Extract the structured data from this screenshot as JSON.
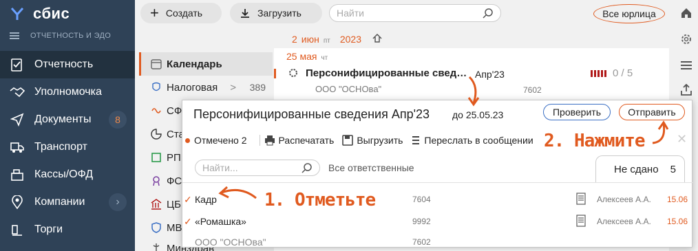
{
  "app": {
    "name": "сбис",
    "section": "ОТЧЕТНОСТЬ И ЭДО"
  },
  "nav": [
    {
      "label": "Отчетность",
      "icon": "report-icon",
      "active": true
    },
    {
      "label": "Уполномочка",
      "icon": "handshake-icon"
    },
    {
      "label": "Документы",
      "icon": "send-icon",
      "badge": "8"
    },
    {
      "label": "Транспорт",
      "icon": "truck-icon"
    },
    {
      "label": "Кассы/ОФД",
      "icon": "cash-register-icon"
    },
    {
      "label": "Компании",
      "icon": "location-icon",
      "chevron": "›"
    },
    {
      "label": "Торги",
      "icon": "auction-icon"
    }
  ],
  "toolbar": {
    "create_label": "Создать",
    "upload_label": "Загрузить",
    "search_placeholder": "Найти",
    "legal_entities": "Все юрлица"
  },
  "datebar": {
    "day": "2",
    "month": "июн",
    "dow": "пт",
    "year": "2023"
  },
  "mid": [
    {
      "label": "Календарь",
      "icon": "calendar-icon"
    },
    {
      "label": "Налоговая",
      "icon": "tax-icon",
      "arrow": ">",
      "count": "389"
    },
    {
      "label": "СФР",
      "icon": "sfr-icon"
    },
    {
      "label": "Статистика",
      "icon": "stats-icon"
    },
    {
      "label": "РПН",
      "icon": "leaf-icon"
    },
    {
      "label": "ФСС",
      "icon": "fss-icon"
    },
    {
      "label": "ЦБ",
      "icon": "bank-icon"
    },
    {
      "label": "МВД",
      "icon": "shield-icon"
    },
    {
      "label": "Минздрав",
      "icon": "health-icon"
    }
  ],
  "main": {
    "date": "25 мая",
    "dow": "чт",
    "row": {
      "title": "Персонифицированные свед…",
      "period": "Апр'23",
      "score": "0 / 5",
      "org": "ООО \"ОСНОва\"",
      "code": "7602"
    }
  },
  "popup": {
    "title": "Персонифицированные сведения Апр'23",
    "due": "до 25.05.23",
    "check_label": "Проверить",
    "send_label": "Отправить",
    "tools": {
      "marked": "Отмечено 2",
      "print": "Распечатать",
      "export": "Выгрузить",
      "forward": "Переслать в сообщении"
    },
    "search_placeholder": "Найти...",
    "responsible": "Все ответственные",
    "tab": {
      "label": "Не сдано",
      "count": "5"
    },
    "rows": [
      {
        "check": "✓",
        "name": "Кадр",
        "code": "7604",
        "person": "Алексеев А.А.",
        "date": "15.06"
      },
      {
        "check": "✓",
        "name": "«Ромашка»",
        "code": "9992",
        "person": "Алексеев А.А.",
        "date": "15.06"
      },
      {
        "check": "",
        "name": "ООО \"ОСНОва\"",
        "code": "7602",
        "person": "",
        "date": ""
      }
    ]
  },
  "annotations": {
    "step1": "1. Отметьте",
    "step2": "2. Нажмите"
  },
  "colors": {
    "accent": "#e05a1f",
    "nav_bg": "#2f4257",
    "link_blue": "#3a6fc4"
  }
}
